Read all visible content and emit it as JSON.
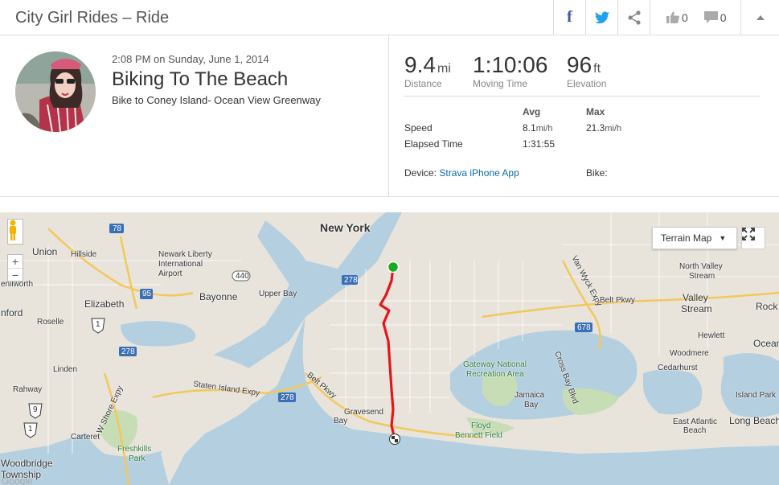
{
  "header": {
    "title": "City Girl Rides – Ride",
    "facebook_label": "f",
    "kudos_count": "0",
    "comments_count": "0"
  },
  "activity": {
    "datetime": "2:08 PM on Sunday, June 1, 2014",
    "name": "Biking To The Beach",
    "description": "Bike to Coney Island- Ocean View Greenway"
  },
  "stats": {
    "distance": {
      "value": "9.4",
      "unit": "mi",
      "label": "Distance"
    },
    "moving_time": {
      "value": "1:10:06",
      "label": "Moving Time"
    },
    "elevation": {
      "value": "96",
      "unit": "ft",
      "label": "Elevation"
    }
  },
  "table": {
    "col_avg": "Avg",
    "col_max": "Max",
    "speed_label": "Speed",
    "speed_avg": "8.1",
    "speed_avg_unit": "mi/h",
    "speed_max": "21.3",
    "speed_max_unit": "mi/h",
    "elapsed_label": "Elapsed Time",
    "elapsed_avg": "1:31:55"
  },
  "device": {
    "label": "Device:",
    "value": "Strava iPhone App",
    "bike_label": "Bike:"
  },
  "map": {
    "type_label": "Terrain Map",
    "zoom_in": "+",
    "zoom_out": "−",
    "labels": {
      "new_york": "New York",
      "union": "Union",
      "hillside": "Hillside",
      "newark": "Newark Liberty",
      "newark2": "International",
      "newark3": "Airport",
      "bayonne": "Bayonne",
      "upper_bay": "Upper Bay",
      "elizabeth": "Elizabeth",
      "roselle": "Roselle",
      "linden": "Linden",
      "rahway": "Rahway",
      "carteret": "Carteret",
      "freshkills": "Freshkills",
      "freshkills2": "Park",
      "woodbridge": "Woodbridge",
      "township": "Township",
      "staten": "Staten Island Expy",
      "w_shore": "W Shore Expy",
      "belt": "Belt Pkwy",
      "gravesend": "Gravesend",
      "gravesend2": "Bay",
      "gateway": "Gateway National",
      "gateway2": "Recreation Area",
      "jamaica_bay": "Jamaica",
      "jamaica_bay2": "Bay",
      "floyd": "Floyd",
      "floyd2": "Bennett Field",
      "cross_bay": "Cross Bay Blvd",
      "van_wyck": "Van Wyck Expy",
      "belt_east": "Belt Pkwy",
      "north_valley": "North Valley",
      "north_valley2": "Stream",
      "valley": "Valley",
      "valley2": "Stream",
      "rock": "Rock",
      "hewlett": "Hewlett",
      "woodmere": "Woodmere",
      "cedarhurst": "Cedarhurst",
      "ocean": "Ocean",
      "island_park": "Island Park",
      "east_atlantic": "East Atlantic",
      "east_atlantic2": "Beach",
      "long_beach": "Long Beach",
      "enilworth": "enilworth",
      "nford": "nford",
      "r78": "78",
      "r278a": "278",
      "r440": "440",
      "r95": "95",
      "r1": "1",
      "r278b": "278",
      "r278c": "278",
      "r9": "9",
      "r1b": "1",
      "r678": "678",
      "google": "Google"
    }
  },
  "colors": {
    "route": "#e8141b",
    "start": "#1aaa25",
    "link": "#0a6ba8"
  }
}
